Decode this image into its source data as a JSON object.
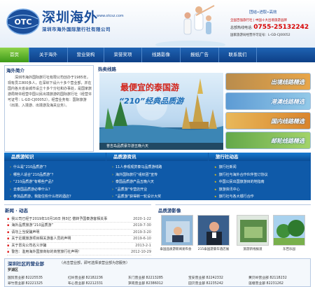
{
  "header": {
    "brand_cn": "深圳海外",
    "brand_url": "www.otcsz.com",
    "company": "深圳市海外国际旅行社有限公司",
    "logo_text": "OTC",
    "slogan": "团结•进取•高效",
    "tagline": "全国百强旅行社 | 中国十大出境旅游品牌",
    "hotline_label": "总部热线电话:",
    "hotline": "0755-25132242",
    "license": "国家旅游局经营许可证号：L-GD-CJ00052"
  },
  "nav": [
    "首页",
    "关于海外",
    "营业架构",
    "荣誉奖项",
    "线路影像",
    "报纸广告",
    "联系我们"
  ],
  "intro": {
    "title": "海外简介",
    "body": "深圳市海外国际旅行社有限公司创办于1985年，现有员工800多人，在深圳下设六十多个营业部，并在国内各大省会城市设立十多个分社和办事处，是国家旅游局特许经营中国公民出境旅游的国际旅行社（经营许可证号：L-GD-CJ00052）。经营业务有：国际旅游（出境、入境游、出境游及海关业务）。"
  },
  "hot": {
    "title": "热卖线路",
    "banner_title": "最便宜的泰国游",
    "banner_sub": "“210”经典品质游",
    "banner_caption": "普吉岛品质豪华游五晚六天",
    "side": [
      "出境线路精选",
      "港澳线路精选",
      "国内线路精选",
      "邮轮线路精选"
    ]
  },
  "band": {
    "col1_title": "品质游知识",
    "col1": [
      "什么是“210品质游”？",
      "哪些人适合“210品质游”？",
      "“210品质游”有哪些产品？",
      "去泰国品质游必带什么？",
      "参加品质游，我能住些什么样的酒店？"
    ],
    "col2_title": "品质游资讯",
    "col2": [
      "11人参观观赏泰马品质游线路",
      "海外国际旅行“组织团”宣传",
      "泰国品质游产品五晚六天",
      "“品质游”专营店开业",
      "“品质游”获得新一轮设计大奖"
    ],
    "col3_title": "旅行社动态",
    "col3": [
      "旅行社新闻",
      "旅行社与海外合作伙伴签订协议",
      "中国公民出国旅游目的地指南",
      "旅游资讯中心",
      "旅行社与各大银行合作"
    ]
  },
  "news": {
    "title": "新闻 · 动态",
    "items": [
      {
        "title": "我公司已经于2019年10月16日 持3亿 偿转予国泰游客相关事",
        "date": "2020-1-22"
      },
      {
        "title": "海外品质旅游“210品质游”",
        "date": "2019-7-30"
      },
      {
        "title": "请勿上当受骗声明",
        "date": "2019-3-20"
      },
      {
        "title": "关于近期旅游项目相关游客人员的声明",
        "date": "2019-6-10"
      },
      {
        "title": "关于冒充公司名义诈骗",
        "date": "2013-2-1"
      },
      {
        "title": "警告：滥用海外国旅商标的商誉旅行社声明！",
        "date": "2012-10-29"
      }
    ]
  },
  "media": {
    "title": "品质游影像",
    "captions": [
      "泰国品质游新闻发布会",
      "215泰国游豪华酒店展",
      "旅游新线报道",
      "东芭乐园"
    ]
  },
  "branches": {
    "title": "深圳社区的营业部",
    "note": "（点击营业部，即可选择该营业部为您服务）",
    "sub": "罗湖区",
    "items": [
      {
        "name": "国贸营业部",
        "tel": "82225535"
      },
      {
        "name": "红岭营业部",
        "tel": "82182236"
      },
      {
        "name": "东门营业部",
        "tel": "82213285"
      },
      {
        "name": "宝安营业部",
        "tel": "82242332"
      },
      {
        "name": "黄贝岭营业部",
        "tel": "82118232"
      },
      {
        "name": "翠竹营业部",
        "tel": "82221325"
      },
      {
        "name": "布心营业部",
        "tel": "82212331"
      },
      {
        "name": "笋岗营业部",
        "tel": "82386012"
      },
      {
        "name": "田贝营业部",
        "tel": "82235242"
      },
      {
        "name": "莲塘营业部",
        "tel": "82231262"
      }
    ]
  }
}
